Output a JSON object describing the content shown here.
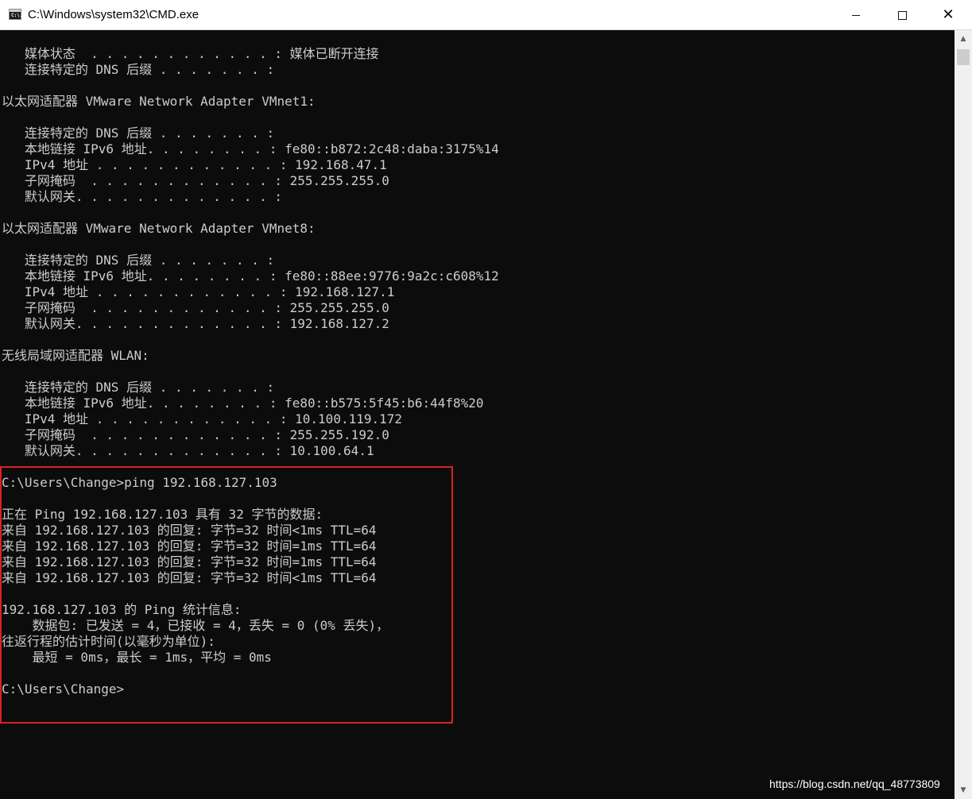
{
  "window": {
    "title": "C:\\Windows\\system32\\CMD.exe",
    "icon_label": "C:\\.",
    "buttons": {
      "minimize": "minimize-icon",
      "maximize": "maximize-icon",
      "close": "close-icon"
    }
  },
  "console": {
    "lines": [
      "   媒体状态  . . . . . . . . . . . . : 媒体已断开连接",
      "   连接特定的 DNS 后缀 . . . . . . . :",
      "",
      "以太网适配器 VMware Network Adapter VMnet1:",
      "",
      "   连接特定的 DNS 后缀 . . . . . . . :",
      "   本地链接 IPv6 地址. . . . . . . . : fe80::b872:2c48:daba:3175%14",
      "   IPv4 地址 . . . . . . . . . . . . : 192.168.47.1",
      "   子网掩码  . . . . . . . . . . . . : 255.255.255.0",
      "   默认网关. . . . . . . . . . . . . :",
      "",
      "以太网适配器 VMware Network Adapter VMnet8:",
      "",
      "   连接特定的 DNS 后缀 . . . . . . . :",
      "   本地链接 IPv6 地址. . . . . . . . : fe80::88ee:9776:9a2c:c608%12",
      "   IPv4 地址 . . . . . . . . . . . . : 192.168.127.1",
      "   子网掩码  . . . . . . . . . . . . : 255.255.255.0",
      "   默认网关. . . . . . . . . . . . . : 192.168.127.2",
      "",
      "无线局域网适配器 WLAN:",
      "",
      "   连接特定的 DNS 后缀 . . . . . . . :",
      "   本地链接 IPv6 地址. . . . . . . . : fe80::b575:5f45:b6:44f8%20",
      "   IPv4 地址 . . . . . . . . . . . . : 10.100.119.172",
      "   子网掩码  . . . . . . . . . . . . : 255.255.192.0",
      "   默认网关. . . . . . . . . . . . . : 10.100.64.1",
      "",
      "C:\\Users\\Change>ping 192.168.127.103",
      "",
      "正在 Ping 192.168.127.103 具有 32 字节的数据:",
      "来自 192.168.127.103 的回复: 字节=32 时间<1ms TTL=64",
      "来自 192.168.127.103 的回复: 字节=32 时间=1ms TTL=64",
      "来自 192.168.127.103 的回复: 字节=32 时间=1ms TTL=64",
      "来自 192.168.127.103 的回复: 字节=32 时间<1ms TTL=64",
      "",
      "192.168.127.103 的 Ping 统计信息:",
      "    数据包: 已发送 = 4，已接收 = 4，丢失 = 0 (0% 丢失)，",
      "往返行程的估计时间(以毫秒为单位):",
      "    最短 = 0ms，最长 = 1ms，平均 = 0ms",
      "",
      "C:\\Users\\Change>"
    ]
  },
  "colors": {
    "console_bg": "#0c0c0c",
    "console_text": "#cccccc",
    "highlight_border": "#e02020"
  },
  "watermark": "https://blog.csdn.net/qq_48773809"
}
